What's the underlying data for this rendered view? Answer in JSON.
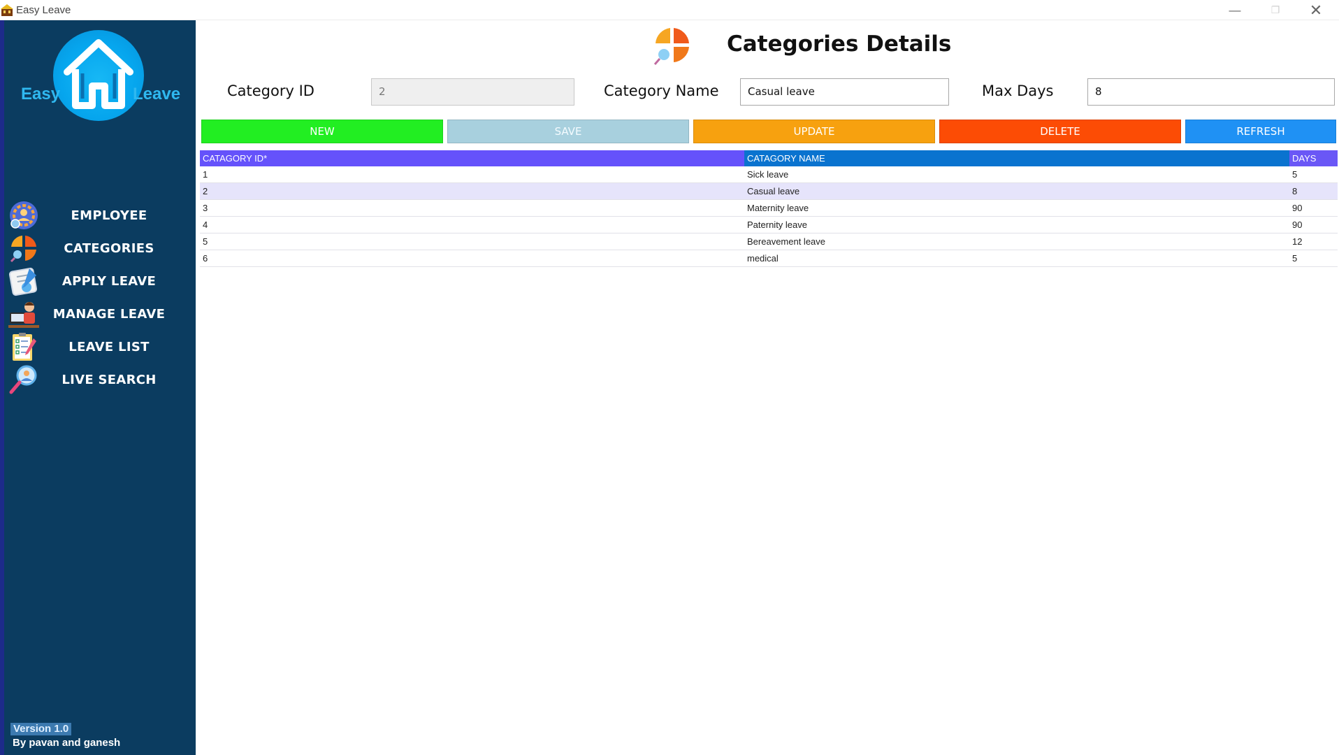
{
  "window": {
    "title": "Easy Leave"
  },
  "sidebar": {
    "logo_left": "Easy",
    "logo_right": "Leave",
    "items": [
      {
        "label": "EMPLOYEE",
        "icon": "employee-icon"
      },
      {
        "label": "CATEGORIES",
        "icon": "categories-icon"
      },
      {
        "label": "APPLY LEAVE",
        "icon": "apply-leave-icon"
      },
      {
        "label": "MANAGE LEAVE",
        "icon": "manage-leave-icon"
      },
      {
        "label": "LEAVE LIST",
        "icon": "leave-list-icon"
      },
      {
        "label": "LIVE SEARCH",
        "icon": "live-search-icon"
      }
    ],
    "version": "Version 1.0",
    "author": "By pavan and ganesh"
  },
  "header": {
    "title": "Categories Details"
  },
  "form": {
    "category_id_label": "Category ID",
    "category_id_value": "2",
    "category_name_label": "Category Name",
    "category_name_value": "Casual leave",
    "max_days_label": "Max Days",
    "max_days_value": "8"
  },
  "buttons": {
    "new": "NEW",
    "save": "SAVE",
    "update": "UPDATE",
    "delete": "DELETE",
    "refresh": "REFRESH"
  },
  "colors": {
    "sidebar": "#0b3c60",
    "new": "#22ee22",
    "save": "#a8d0de",
    "update": "#f7a10f",
    "delete": "#fc4c05",
    "refresh": "#1f91f4",
    "col_id_header": "#6552fb",
    "col_name_header": "#0a73cf",
    "col_days_header": "#6a57f6"
  },
  "table": {
    "headers": [
      "CATAGORY ID*",
      "CATAGORY NAME",
      "DAYS"
    ],
    "rows": [
      [
        "1",
        "Sick leave",
        "5"
      ],
      [
        "2",
        "Casual leave",
        "8"
      ],
      [
        "3",
        "Maternity leave",
        "90"
      ],
      [
        "4",
        "Paternity leave",
        "90"
      ],
      [
        "5",
        "Bereavement leave",
        "12"
      ],
      [
        "6",
        "medical",
        "5"
      ]
    ],
    "selected_row": 1
  }
}
